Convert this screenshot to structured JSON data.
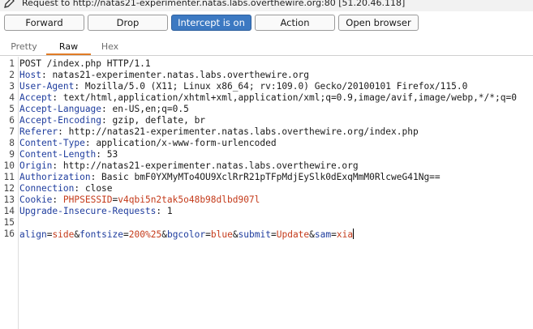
{
  "header": {
    "request_text": "Request to http://natas21-experimenter.natas.labs.overthewire.org:80  [51.20.46.118]"
  },
  "toolbar": {
    "forward": "Forward",
    "drop": "Drop",
    "intercept": "Intercept is on",
    "action": "Action",
    "open_browser": "Open browser"
  },
  "tabs": {
    "pretty": "Pretty",
    "raw": "Raw",
    "hex": "Hex",
    "active": "Raw"
  },
  "colors": {
    "accent": "#3c79c2",
    "tab_underline": "#e07b25",
    "key": "#1f3d9e",
    "value": "#c43a1a"
  },
  "lines": [
    {
      "n": "1",
      "text": "POST /index.php HTTP/1.1"
    },
    {
      "n": "2",
      "key": "Host",
      "val": "natas21-experimenter.natas.labs.overthewire.org"
    },
    {
      "n": "3",
      "key": "User-Agent",
      "val": "Mozilla/5.0 (X11; Linux x86_64; rv:109.0) Gecko/20100101 Firefox/115.0"
    },
    {
      "n": "4",
      "key": "Accept",
      "val": "text/html,application/xhtml+xml,application/xml;q=0.9,image/avif,image/webp,*/*;q=0"
    },
    {
      "n": "5",
      "key": "Accept-Language",
      "val": "en-US,en;q=0.5"
    },
    {
      "n": "6",
      "key": "Accept-Encoding",
      "val": "gzip, deflate, br"
    },
    {
      "n": "7",
      "key": "Referer",
      "val": "http://natas21-experimenter.natas.labs.overthewire.org/index.php"
    },
    {
      "n": "8",
      "key": "Content-Type",
      "val": "application/x-www-form-urlencoded"
    },
    {
      "n": "9",
      "key": "Content-Length",
      "val": "53"
    },
    {
      "n": "10",
      "key": "Origin",
      "val": "http://natas21-experimenter.natas.labs.overthewire.org"
    },
    {
      "n": "11",
      "key": "Authorization",
      "val": "Basic bmF0YXMyMTo4OU9XclRrR21pTFpMdjEySlk0dExqMmM0RlcweG41Ng=="
    },
    {
      "n": "12",
      "key": "Connection",
      "val": "close"
    },
    {
      "n": "13",
      "key": "Cookie",
      "cookie_name": "PHPSESSID",
      "cookie_val": "v4qbi5n2tak5o48b98dlbd907l"
    },
    {
      "n": "14",
      "key": "Upgrade-Insecure-Requests",
      "val": "1"
    },
    {
      "n": "15",
      "text": ""
    },
    {
      "n": "16",
      "params": [
        {
          "name": "align",
          "value": "side"
        },
        {
          "name": "fontsize",
          "value": "200%25"
        },
        {
          "name": "bgcolor",
          "value": "blue"
        },
        {
          "name": "submit",
          "value": "Update"
        },
        {
          "name": "sam",
          "value": "xia"
        }
      ]
    }
  ]
}
